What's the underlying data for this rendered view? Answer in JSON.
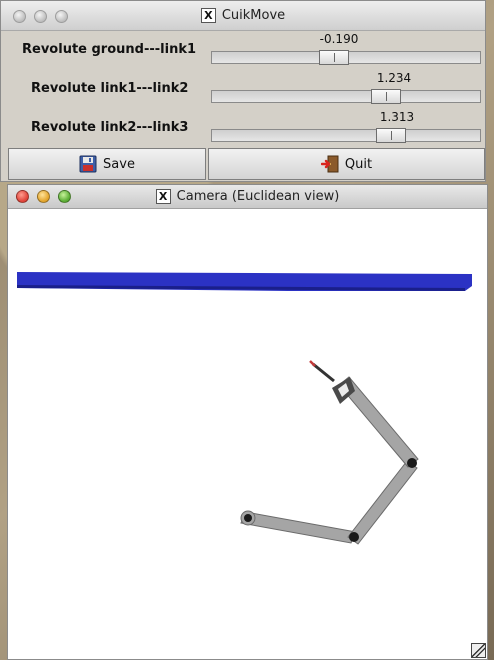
{
  "desktop": {
    "background": "textured stone"
  },
  "top_window": {
    "title": "CuikMove",
    "window_buttons": [
      "close",
      "minimize",
      "zoom"
    ],
    "sliders": [
      {
        "label": "Revolute ground---link1",
        "value": "-0.190",
        "fraction": 0.45
      },
      {
        "label": "Revolute link1---link2",
        "value": "1.234",
        "fraction": 0.67
      },
      {
        "label": "Revolute link2---link3",
        "value": "1.313",
        "fraction": 0.69
      }
    ],
    "buttons": {
      "save_label": "Save",
      "quit_label": "Quit"
    }
  },
  "camera_window": {
    "title": "Camera (Euclidean view)",
    "window_buttons": [
      "close",
      "minimize",
      "zoom"
    ],
    "scene": {
      "ground_color": "#2b32c4",
      "link_color": "#a5a5a5",
      "joint_color": "#1a1a1a",
      "tool_color": "#4a4a4a",
      "tip_color": "#c23a3a"
    }
  }
}
